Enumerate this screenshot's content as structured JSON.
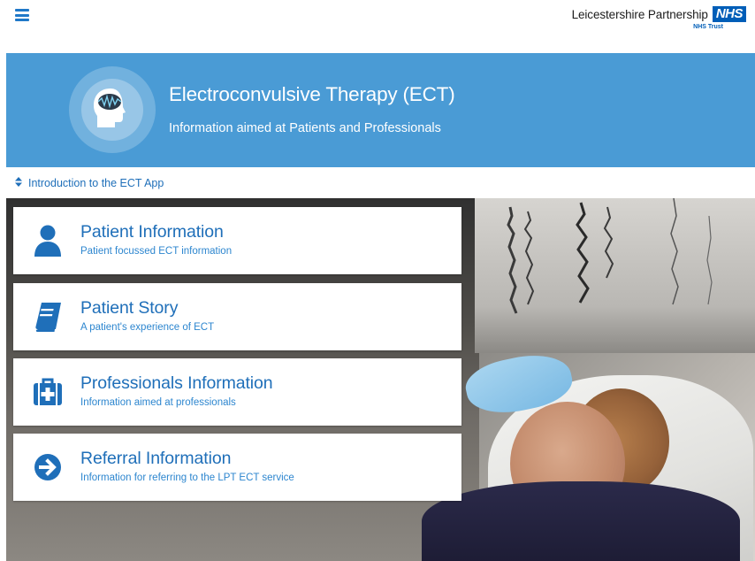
{
  "header": {
    "menu_icon": "hamburger-icon",
    "org_name": "Leicestershire Partnership",
    "nhs_badge": "NHS",
    "trust_label": "NHS Trust"
  },
  "banner": {
    "icon": "head-brainwave-icon",
    "title": "Electroconvulsive Therapy (ECT)",
    "subtitle": "Information aimed at Patients and Professionals",
    "background_color": "#4a9bd5"
  },
  "intro": {
    "icon": "sort-arrows-icon",
    "label": "Introduction to the ECT App"
  },
  "menu": [
    {
      "icon": "user-icon",
      "title": "Patient Information",
      "description": "Patient focussed ECT information"
    },
    {
      "icon": "book-icon",
      "title": "Patient Story",
      "description": "A patient's experience of ECT"
    },
    {
      "icon": "medical-kit-icon",
      "title": "Professionals Information",
      "description": "Information aimed at professionals"
    },
    {
      "icon": "arrow-circle-right-icon",
      "title": "Referral Information",
      "description": "Information for referring to the LPT ECT service"
    }
  ],
  "colors": {
    "accent": "#1f6fb9",
    "nhs_blue": "#005eb8",
    "card_background": "#ffffff"
  }
}
